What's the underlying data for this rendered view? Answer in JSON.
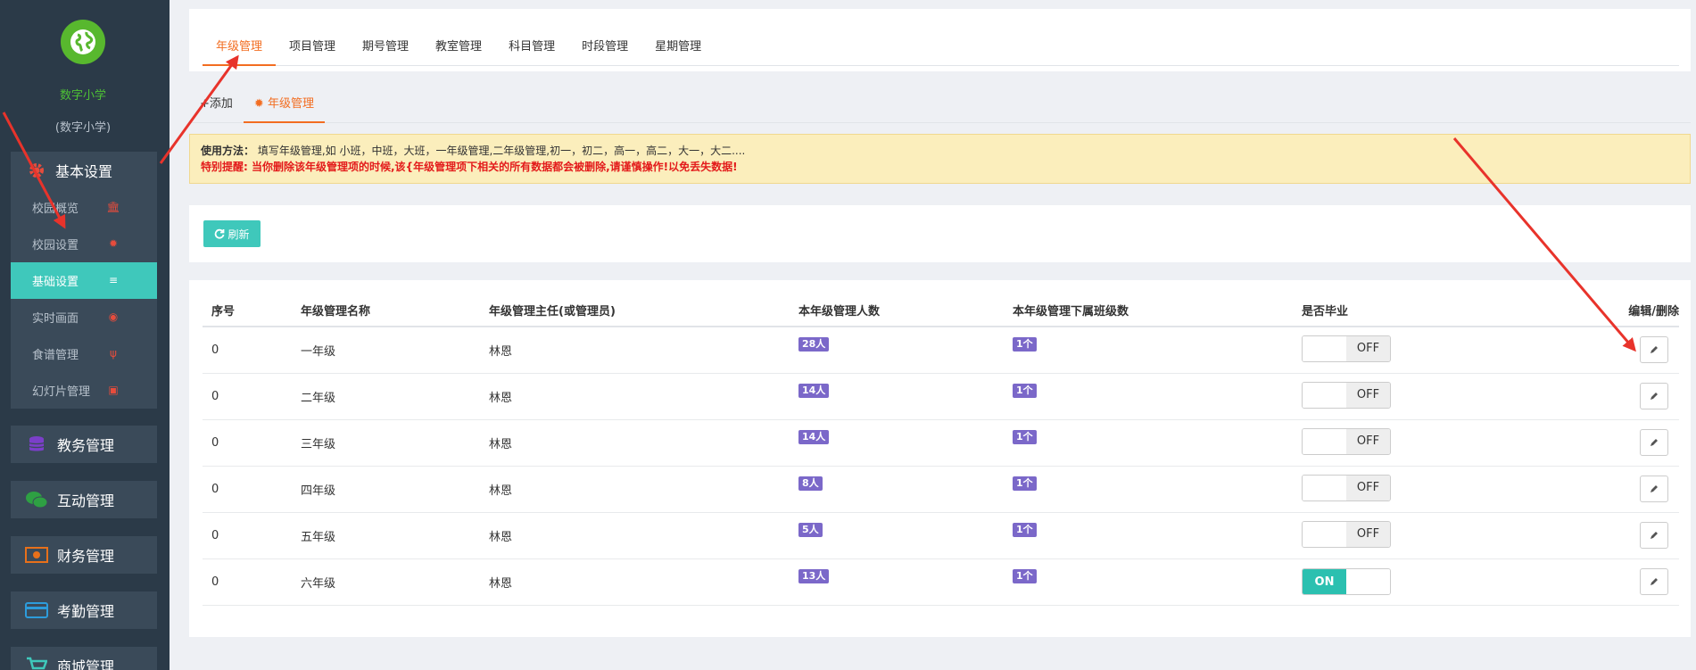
{
  "sidebar": {
    "school_name": "数字小学",
    "school_sub": "(数字小学)",
    "basic_group": {
      "label": "基本设置",
      "items": [
        {
          "label": "校园概览",
          "icon": "bank-icon",
          "active": false
        },
        {
          "label": "校园设置",
          "icon": "gear-icon",
          "active": false
        },
        {
          "label": "基础设置",
          "icon": "list-icon",
          "active": true
        },
        {
          "label": "实时画面",
          "icon": "eye-icon",
          "active": false
        },
        {
          "label": "食谱管理",
          "icon": "cutlery-icon",
          "active": false
        },
        {
          "label": "幻灯片管理",
          "icon": "image-icon",
          "active": false
        }
      ]
    },
    "groups": [
      {
        "label": "教务管理",
        "icon": "database-icon"
      },
      {
        "label": "互动管理",
        "icon": "wechat-icon"
      },
      {
        "label": "财务管理",
        "icon": "money-icon"
      },
      {
        "label": "考勤管理",
        "icon": "card-icon"
      },
      {
        "label": "商城管理",
        "icon": "cart-icon"
      }
    ]
  },
  "top_tabs": [
    "年级管理",
    "项目管理",
    "期号管理",
    "教室管理",
    "科目管理",
    "时段管理",
    "星期管理"
  ],
  "sub_tabs": {
    "add": "+添加",
    "current": "年级管理"
  },
  "notice": {
    "usage_label": "使用方法：",
    "usage_text": "填写年级管理,如 小班，中班，大班，一年级管理,二年级管理,初一，初二，高一，高二，大一，大二....",
    "warn_text": "特别提醒: 当你删除该年级管理项的时候,该{年级管理项下相关的所有数据都会被删除,请谨慎操作!以免丢失数据!"
  },
  "toolbar": {
    "refresh_label": "刷新"
  },
  "table": {
    "headers": [
      "序号",
      "年级管理名称",
      "年级管理主任(或管理员)",
      "本年级管理人数",
      "本年级管理下属班级数",
      "是否毕业",
      "编辑/删除"
    ],
    "rows": [
      {
        "no": "0",
        "name": "一年级",
        "head": "林恩",
        "people": "28人",
        "classes": "1个",
        "graduated": false
      },
      {
        "no": "0",
        "name": "二年级",
        "head": "林恩",
        "people": "14人",
        "classes": "1个",
        "graduated": false
      },
      {
        "no": "0",
        "name": "三年级",
        "head": "林恩",
        "people": "14人",
        "classes": "1个",
        "graduated": false
      },
      {
        "no": "0",
        "name": "四年级",
        "head": "林恩",
        "people": "8人",
        "classes": "1个",
        "graduated": false
      },
      {
        "no": "0",
        "name": "五年级",
        "head": "林恩",
        "people": "5人",
        "classes": "1个",
        "graduated": false
      },
      {
        "no": "0",
        "name": "六年级",
        "head": "林恩",
        "people": "13人",
        "classes": "1个",
        "graduated": true
      }
    ],
    "switch_on": "ON",
    "switch_off": "OFF"
  },
  "colors": {
    "accent": "#f26d21",
    "teal": "#3fc8bb",
    "badge": "#7b68c9",
    "sidebar": "#2b3a48",
    "arrow": "#e8332b"
  }
}
